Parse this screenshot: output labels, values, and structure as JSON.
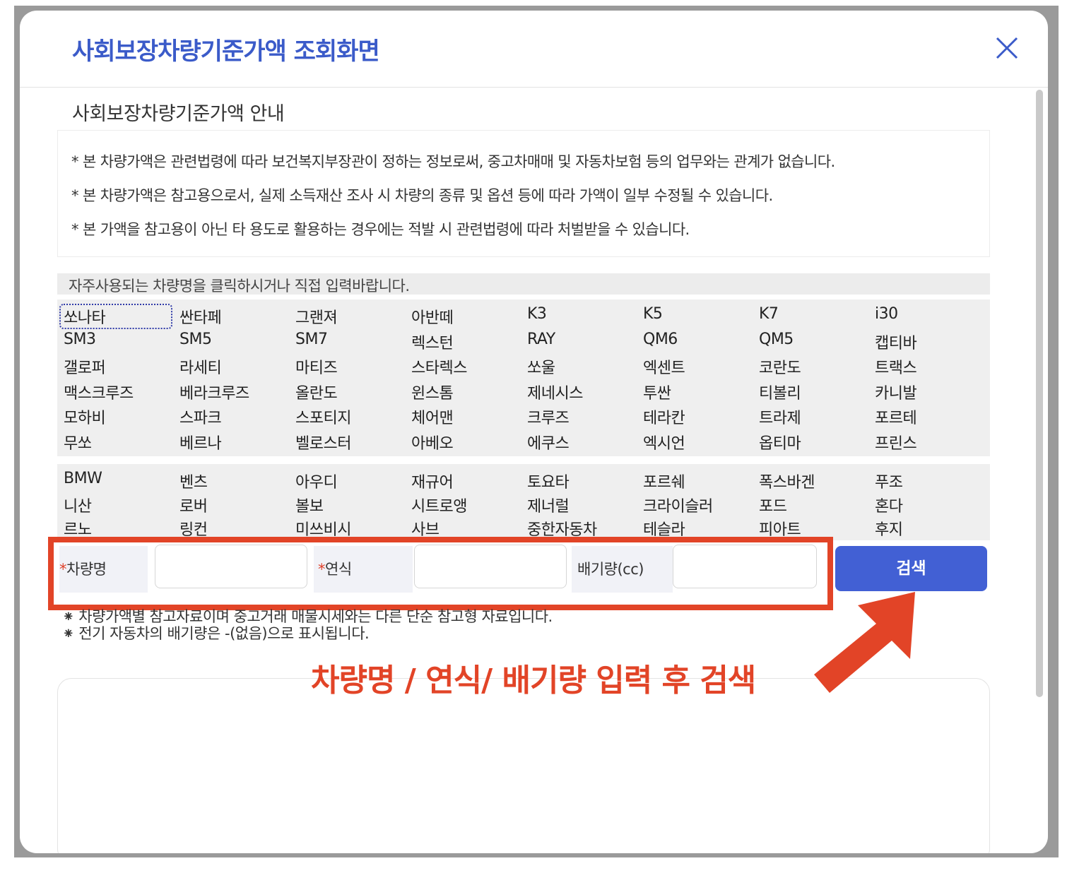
{
  "modal": {
    "title": "사회보장차량기준가액 조회화면",
    "section_title": "사회보장차량기준가액 안내",
    "notices": [
      "* 본 차량가액은 관련법령에 따라 보건복지부장관이 정하는 정보로써, 중고차매매 및 자동차보험 등의 업무와는 관계가 없습니다.",
      "* 본 차량가액은 참고용으로서, 실제 소득재산 조사 시 차량의 종류 및 옵션 등에 따라 가액이 일부 수정될 수 있습니다.",
      "* 본 가액을 참고용이 아닌 타 용도로 활용하는 경우에는 적발 시 관련법령에 따라 처벌받을 수 있습니다."
    ],
    "hint": "자주사용되는 차량명을 클릭하시거나 직접 입력바랍니다.",
    "domestic_cars": [
      [
        "쏘나타",
        "싼타페",
        "그랜져",
        "아반떼",
        "K3",
        "K5",
        "K7",
        "i30"
      ],
      [
        "SM3",
        "SM5",
        "SM7",
        "렉스턴",
        "RAY",
        "QM6",
        "QM5",
        "캡티바"
      ],
      [
        "갤로퍼",
        "라세티",
        "마티즈",
        "스타렉스",
        "쏘울",
        "엑센트",
        "코란도",
        "트랙스"
      ],
      [
        "맥스크루즈",
        "베라크루즈",
        "올란도",
        "윈스톰",
        "제네시스",
        "투싼",
        "티볼리",
        "카니발"
      ],
      [
        "모하비",
        "스파크",
        "스포티지",
        "체어맨",
        "크루즈",
        "테라칸",
        "트라제",
        "포르테"
      ],
      [
        "무쏘",
        "베르나",
        "벨로스터",
        "아베오",
        "에쿠스",
        "엑시언",
        "옵티마",
        "프린스"
      ]
    ],
    "import_cars": [
      [
        "BMW",
        "벤츠",
        "아우디",
        "재규어",
        "토요타",
        "포르쉐",
        "폭스바겐",
        "푸조"
      ],
      [
        "니산",
        "로버",
        "볼보",
        "시트로앵",
        "제너럴",
        "크라이슬러",
        "포드",
        "혼다"
      ],
      [
        "르노",
        "링컨",
        "미쓰비시",
        "사브",
        "중한자동차",
        "테슬라",
        "피아트",
        "후지"
      ]
    ],
    "form": {
      "required_mark": "*",
      "car_name_label": "차량명",
      "year_label": "연식",
      "displacement_label": "배기량(cc)",
      "car_name_value": "",
      "year_value": "",
      "displacement_value": "",
      "search_button": "검색"
    },
    "footnotes": [
      "⁕ 차량가액별 참고자료이며 중고거래 매물시세와는 다른 단순 참고형 자료입니다.",
      "⁕ 전기 자동차의 배기량은 -(없음)으로 표시됩니다."
    ]
  },
  "annotation": {
    "text": "차량명 / 연식/ 배기량 입력 후 검색",
    "color": "#e24427"
  },
  "icons": {
    "close": "close-icon",
    "arrow": "arrow-icon"
  },
  "colors": {
    "title": "#3b5bc9",
    "button": "#4260d4",
    "highlight": "#e24427"
  }
}
